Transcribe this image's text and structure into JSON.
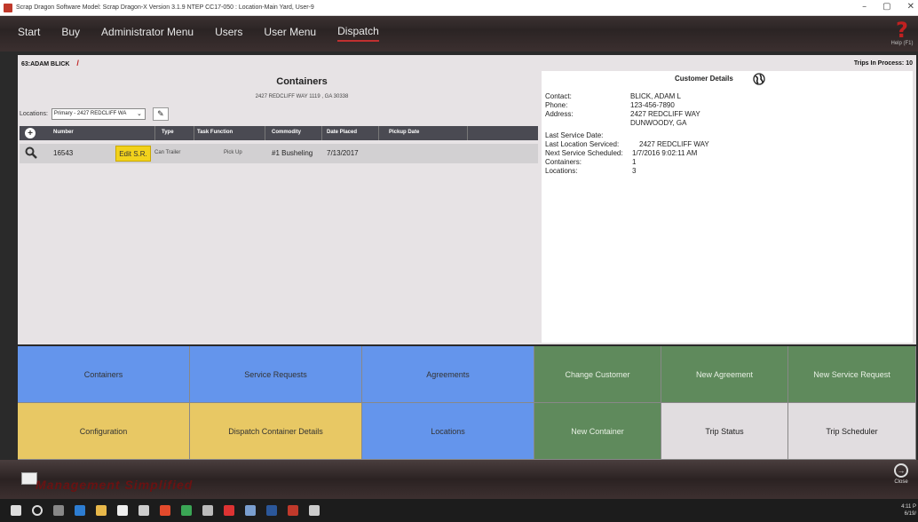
{
  "window": {
    "title": "Scrap Dragon Software Model: Scrap Dragon-X Version 3.1.9 NTEP CC17-050 : Location-Main Yard, User-9",
    "controls": [
      "–",
      "▢",
      "✕"
    ]
  },
  "nav": {
    "items": [
      "Start",
      "Buy",
      "Administrator Menu",
      "Users",
      "User Menu",
      "Dispatch"
    ],
    "active": "Dispatch",
    "help_label": "Help (F1)"
  },
  "header": {
    "customer": "63:ADAM BLICK",
    "trips_label": "Trips In Process: 10"
  },
  "containers": {
    "title": "Containers",
    "address": "2427 REDCLIFF WAY 1119 , GA 30338",
    "locations_label": "Locations:",
    "location_selected": "Primary - 2427 REDCLIFF WA"
  },
  "grid": {
    "columns": [
      "Number",
      "Type",
      "Task Function",
      "Commodity",
      "Date Placed",
      "Pickup Date"
    ],
    "rows": [
      {
        "number": "16543",
        "edit_label": "Edit S.R.",
        "type": "Can Trailer",
        "task_function": "Pick Up",
        "commodity": "#1 Busheling",
        "date_placed": "7/13/2017",
        "pickup_date": ""
      }
    ]
  },
  "customer_details": {
    "title": "Customer Details",
    "fields": [
      {
        "label": "Contact:",
        "value": "BLICK, ADAM L"
      },
      {
        "label": "Phone:",
        "value": "123-456-7890"
      },
      {
        "label": "Address:",
        "value": "2427 REDCLIFF WAY"
      },
      {
        "label": "",
        "value": "DUNWOODY, GA"
      },
      {
        "label": "Last Service Date:",
        "value": ""
      },
      {
        "label": "Last Location Serviced:",
        "value": "2427 REDCLIFF WAY"
      },
      {
        "label": "Next Service Scheduled:",
        "value": "1/7/2016 9:02:11 AM"
      },
      {
        "label": "Containers:",
        "value": "1"
      },
      {
        "label": "Locations:",
        "value": "3"
      }
    ]
  },
  "buttons": {
    "row1": [
      "Containers",
      "Service Requests",
      "Agreements",
      "Change Customer",
      "New Agreement",
      "New Service Request"
    ],
    "row2": [
      "Configuration",
      "Dispatch Container Details",
      "Locations",
      "New Container",
      "Trip Status",
      "Trip Scheduler"
    ]
  },
  "colors": {
    "blue": "#6495ec",
    "yellow": "#e8c864",
    "green": "#5f8a5c",
    "gray": "#e1dde0",
    "accent_red": "#c02020"
  },
  "footer": {
    "brand_text": "Management Simplified",
    "close_label": "Close",
    "clock_time": "4:11 P",
    "clock_date": "6/19/"
  }
}
